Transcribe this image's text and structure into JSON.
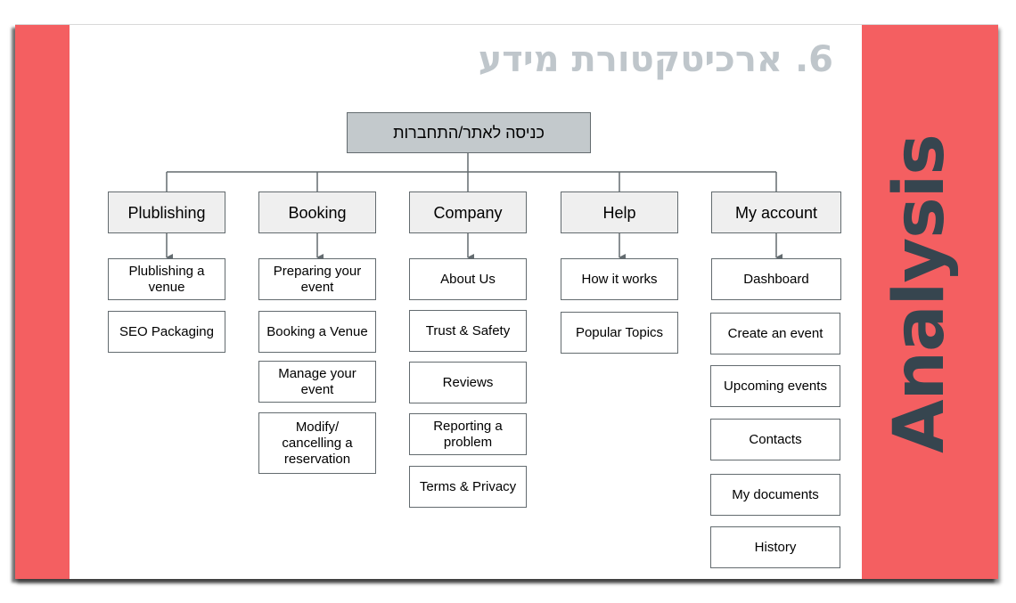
{
  "slide": {
    "title": "6. ארכיטקטורת מידע",
    "side_label": "Analysis",
    "accent_color": "#f45f61",
    "side_label_color": "#36454f",
    "title_color": "#bfc6cb"
  },
  "diagram": {
    "root": {
      "label": "כניסה לאתר/התחברות"
    },
    "categories": [
      {
        "label": "Plublishing",
        "children": [
          "Plublishing a venue",
          "SEO Packaging"
        ]
      },
      {
        "label": "Booking",
        "children": [
          "Preparing your event",
          "Booking a Venue",
          "Manage your event",
          "Modify/ cancelling a reservation"
        ]
      },
      {
        "label": "Company",
        "children": [
          "About Us",
          "Trust & Safety",
          "Reviews",
          "Reporting a problem",
          "Terms & Privacy"
        ]
      },
      {
        "label": "Help",
        "children": [
          "How it works",
          "Popular Topics"
        ]
      },
      {
        "label": "My account",
        "children": [
          "Dashboard",
          "Create an event",
          "Upcoming events",
          "Contacts",
          "My documents",
          "History"
        ]
      }
    ]
  }
}
